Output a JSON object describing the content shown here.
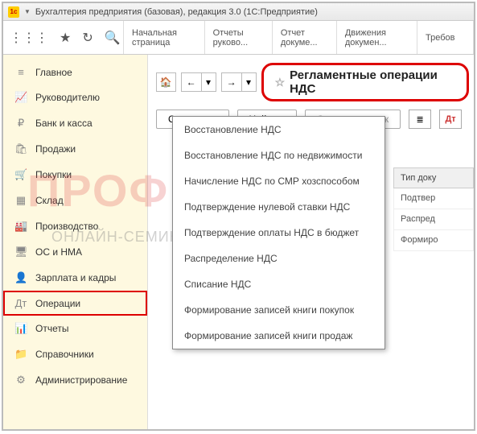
{
  "titlebar": {
    "text": "Бухгалтерия предприятия (базовая), редакция 3.0  (1С:Предприятие)"
  },
  "tabs": [
    {
      "label": "Начальная страница"
    },
    {
      "label": "Отчеты руково..."
    },
    {
      "label": "Отчет докуме..."
    },
    {
      "label": "Движения докумен..."
    },
    {
      "label": "Требов"
    }
  ],
  "sidebar": [
    {
      "icon": "≡",
      "label": "Главное"
    },
    {
      "icon": "📈",
      "label": "Руководителю"
    },
    {
      "icon": "₽",
      "label": "Банк и касса"
    },
    {
      "icon": "🛍",
      "label": "Продажи"
    },
    {
      "icon": "🛒",
      "label": "Покупки"
    },
    {
      "icon": "▦",
      "label": "Склад"
    },
    {
      "icon": "🏭",
      "label": "Производство"
    },
    {
      "icon": "🖥",
      "label": "ОС и НМА"
    },
    {
      "icon": "👤",
      "label": "Зарплата и кадры"
    },
    {
      "icon": "Дт",
      "label": "Операции"
    },
    {
      "icon": "📊",
      "label": "Отчеты"
    },
    {
      "icon": "📁",
      "label": "Справочники"
    },
    {
      "icon": "⚙",
      "label": "Администрирование"
    }
  ],
  "page_title": "Регламентные операции НДС",
  "buttons": {
    "create": "Создать",
    "find": "Найти...",
    "cancel_search": "Отменить поиск"
  },
  "menu_items": [
    "Восстановление НДС",
    "Восстановление НДС по недвижимости",
    "Начисление НДС по СМР хозспособом",
    "Подтверждение нулевой ставки НДС",
    "Подтверждение оплаты НДС в бюджет",
    "Распределение НДС",
    "Списание НДС",
    "Формирование записей книги покупок",
    "Формирование записей книги продаж"
  ],
  "table": {
    "header": "Тип доку",
    "rows": [
      "Подтвер",
      "Распред",
      "Формиро"
    ]
  },
  "watermark": {
    "line1": "ПРОФБУХ8.р",
    "line2": "ОНЛАЙН-СЕМИНАРЫ И ВИДЕОКУРСЫ 1С:8"
  }
}
